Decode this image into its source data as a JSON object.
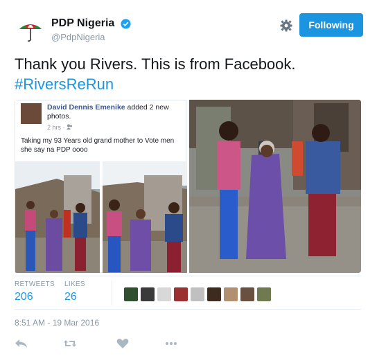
{
  "account": {
    "display_name": "PDP Nigeria",
    "handle": "@PdpNigeria",
    "verified_icon": "verified-badge-icon",
    "follow_label": "Following",
    "brand_color": "#1b95e0"
  },
  "tweet": {
    "text": "Thank you Rivers. This is from Facebook.",
    "hashtag": "#RiversReRun"
  },
  "embedded_post": {
    "author": "David Dennis Emenike",
    "action": " added 2 new photos.",
    "time": "2 hrs",
    "caption": "Taking my 93 Years old grand mother to Vote men she say na PDP oooo"
  },
  "stats": {
    "retweets_label": "RETWEETS",
    "retweets_value": "206",
    "likes_label": "LIKES",
    "likes_value": "26"
  },
  "timestamp": "8:51 AM - 19 Mar 2016",
  "actions": [
    "reply-icon",
    "retweet-icon",
    "like-icon",
    "more-icon"
  ],
  "likers": [
    {
      "color": "#2f4f2f"
    },
    {
      "color": "#3a3a3a"
    },
    {
      "color": "#d8d8d8"
    },
    {
      "color": "#9a3030"
    },
    {
      "color": "#c0c0c0"
    },
    {
      "color": "#3d2b20"
    },
    {
      "color": "#b09070"
    },
    {
      "color": "#6a5040"
    },
    {
      "color": "#707a50"
    }
  ]
}
